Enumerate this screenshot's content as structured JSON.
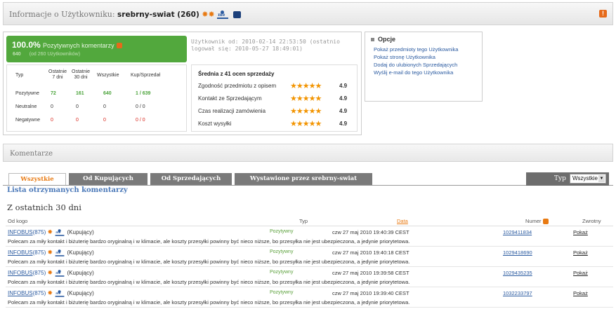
{
  "header": {
    "prefix": "Informacje o Użytkowniku: ",
    "username": "srebrny-swiat",
    "rating": "(260)",
    "alert": "!"
  },
  "summary": {
    "percent": "100.0%",
    "percent_label": "Pozytywnych komentarzy",
    "badge": "!",
    "count": "640",
    "count_sub": "(od 260 Użytkowników)",
    "since": "Użytkownik od: 2010-02-14 22:53:50 (ostatnio logował się: 2010-05-27 18:49:01)"
  },
  "stats": {
    "headers": [
      "Typ",
      "Ostatnie 7 dni",
      "Ostatnie 30 dni",
      "Wszystkie",
      "Kup/Sprzedał"
    ],
    "rows": [
      {
        "type": "Pozytywne",
        "d7": "72",
        "d30": "161",
        "all": "640",
        "kup": "1 / 639"
      },
      {
        "type": "Neutralne",
        "d7": "0",
        "d30": "0",
        "all": "0",
        "kup": "0 / 0"
      },
      {
        "type": "Negatywne",
        "d7": "0",
        "d30": "0",
        "all": "0",
        "kup": "0 / 0"
      }
    ],
    "colors": {
      "pos": "#4aa33a",
      "neu": "#333333",
      "neg": "#d9261c"
    }
  },
  "ratings": {
    "title": "Średnia z 41 ocen sprzedaży",
    "items": [
      {
        "label": "Zgodność przedmiotu z opisem",
        "stars": 5,
        "value": "4.9"
      },
      {
        "label": "Kontakt ze Sprzedającym",
        "stars": 5,
        "value": "4.9"
      },
      {
        "label": "Czas realizacji zamówienia",
        "stars": 5,
        "value": "4.9"
      },
      {
        "label": "Koszt wysyłki",
        "stars": 5,
        "value": "4.9"
      }
    ]
  },
  "options": {
    "title": "Opcje",
    "links": [
      "Pokaż przedmioty tego Użytkownika",
      "Pokaż stronę Użytkownika",
      "Dodaj do ulubionych Sprzedających",
      "Wyślij e-mail do tego Użytkownika"
    ]
  },
  "comments": {
    "section_title": "Komentarze",
    "tabs": [
      "Wszystkie",
      "Od Kupujących",
      "Od Sprzedających",
      "Wystawione przez srebrny-swiat"
    ],
    "typ_label": "Typ",
    "typ_value": "Wszystkie",
    "list_title": "Lista otrzymanych komentarzy",
    "period_title": "Z ostatnich 30 dni",
    "columns": {
      "from": "Od kogo",
      "type": "Typ",
      "date": "Data",
      "number": "Numer",
      "return": "Zwrotny"
    },
    "rows": [
      {
        "nick": "INFOBUS",
        "count": "(875)",
        "role": "(Kupujący)",
        "type": "Pozytywny",
        "date": "czw 27 maj 2010 19:40:39 CEST",
        "number": "1029411834",
        "return": "Pokaż",
        "msg": "Polecam za miły kontakt i biżuterię bardzo oryginalną i w klimacie, ale koszty przesyłki powinny być nieco niższe, bo przesyłka nie jest ubezpieczona, a jedynie priorytetowa."
      },
      {
        "nick": "INFOBUS",
        "count": "(875)",
        "role": "(Kupujący)",
        "type": "Pozytywny",
        "date": "czw 27 maj 2010 19:40:18 CEST",
        "number": "1029418690",
        "return": "Pokaż",
        "msg": "Polecam za miły kontakt i biżuterię bardzo oryginalną i w klimacie, ale koszty przesyłki powinny być nieco niższe, bo przesyłka nie jest ubezpieczona, a jedynie priorytetowa."
      },
      {
        "nick": "INFOBUS",
        "count": "(875)",
        "role": "(Kupujący)",
        "type": "Pozytywny",
        "date": "czw 27 maj 2010 19:39:58 CEST",
        "number": "1029435235",
        "return": "Pokaż",
        "msg": "Polecam za miły kontakt i biżuterię bardzo oryginalną i w klimacie, ale koszty przesyłki powinny być nieco niższe, bo przesyłka nie jest ubezpieczona, a jedynie priorytetowa."
      },
      {
        "nick": "INFOBUS",
        "count": "(875)",
        "role": "(Kupujący)",
        "type": "Pozytywny",
        "date": "czw 27 maj 2010 19:39:40 CEST",
        "number": "1032233797",
        "return": "Pokaż",
        "msg": "Polecam za miły kontakt i biżuterię bardzo oryginalną i w klimacie, ale koszty przesyłki powinny być nieco niższe, bo przesyłka nie jest ubezpieczona, a jedynie priorytetowa."
      }
    ]
  }
}
